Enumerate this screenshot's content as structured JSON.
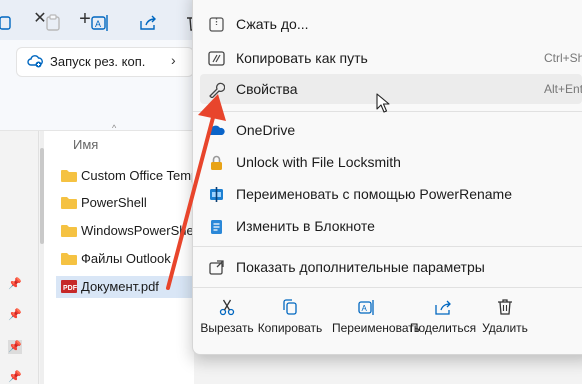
{
  "tabbar": {
    "close_glyph": "✕",
    "new_tab_glyph": "+"
  },
  "address": {
    "backup_label": "Запуск рез. коп.",
    "chevron": "›"
  },
  "toolbar": {
    "icons": [
      "copy-icon",
      "paste-icon",
      "rename-icon",
      "share-icon",
      "delete-icon"
    ]
  },
  "files": {
    "column_name": "Имя",
    "sort_caret": "^",
    "items": [
      {
        "name": "Custom Office Templates",
        "type": "folder"
      },
      {
        "name": "PowerShell",
        "type": "folder"
      },
      {
        "name": "WindowsPowerShell",
        "type": "folder"
      },
      {
        "name": "Файлы Outlook",
        "type": "folder"
      },
      {
        "name": "Документ.pdf",
        "type": "pdf",
        "selected": true
      }
    ]
  },
  "menu": {
    "items": [
      {
        "label": "Сжать до...",
        "icon": "zip-icon",
        "shortcut": ""
      },
      {
        "label": "Копировать как путь",
        "icon": "copy-path-icon",
        "shortcut": "Ctrl+Shift+C"
      },
      {
        "label": "Свойства",
        "icon": "wrench-icon",
        "shortcut": "Alt+Enter",
        "hover": true
      },
      {
        "label": "OneDrive",
        "icon": "onedrive-icon",
        "shortcut": ""
      },
      {
        "label": "Unlock with File Locksmith",
        "icon": "lock-icon",
        "shortcut": ""
      },
      {
        "label": "Переименовать с помощью PowerRename",
        "icon": "powerrename-icon",
        "shortcut": ""
      },
      {
        "label": "Изменить в Блокноте",
        "icon": "notepad-icon",
        "shortcut": ""
      },
      {
        "label": "Показать дополнительные параметры",
        "icon": "more-options-icon",
        "shortcut": ""
      }
    ],
    "quick_actions": [
      {
        "label": "Вырезать",
        "icon": "cut-icon"
      },
      {
        "label": "Копировать",
        "icon": "copy-icon"
      },
      {
        "label": "Переименовать",
        "icon": "rename-icon"
      },
      {
        "label": "Поделиться",
        "icon": "share-icon"
      },
      {
        "label": "Удалить",
        "icon": "delete-icon"
      }
    ]
  },
  "colors": {
    "accent": "#0067c0",
    "arrow": "#e8452c",
    "folder": "#f5c242",
    "pdf": "#c62828"
  }
}
